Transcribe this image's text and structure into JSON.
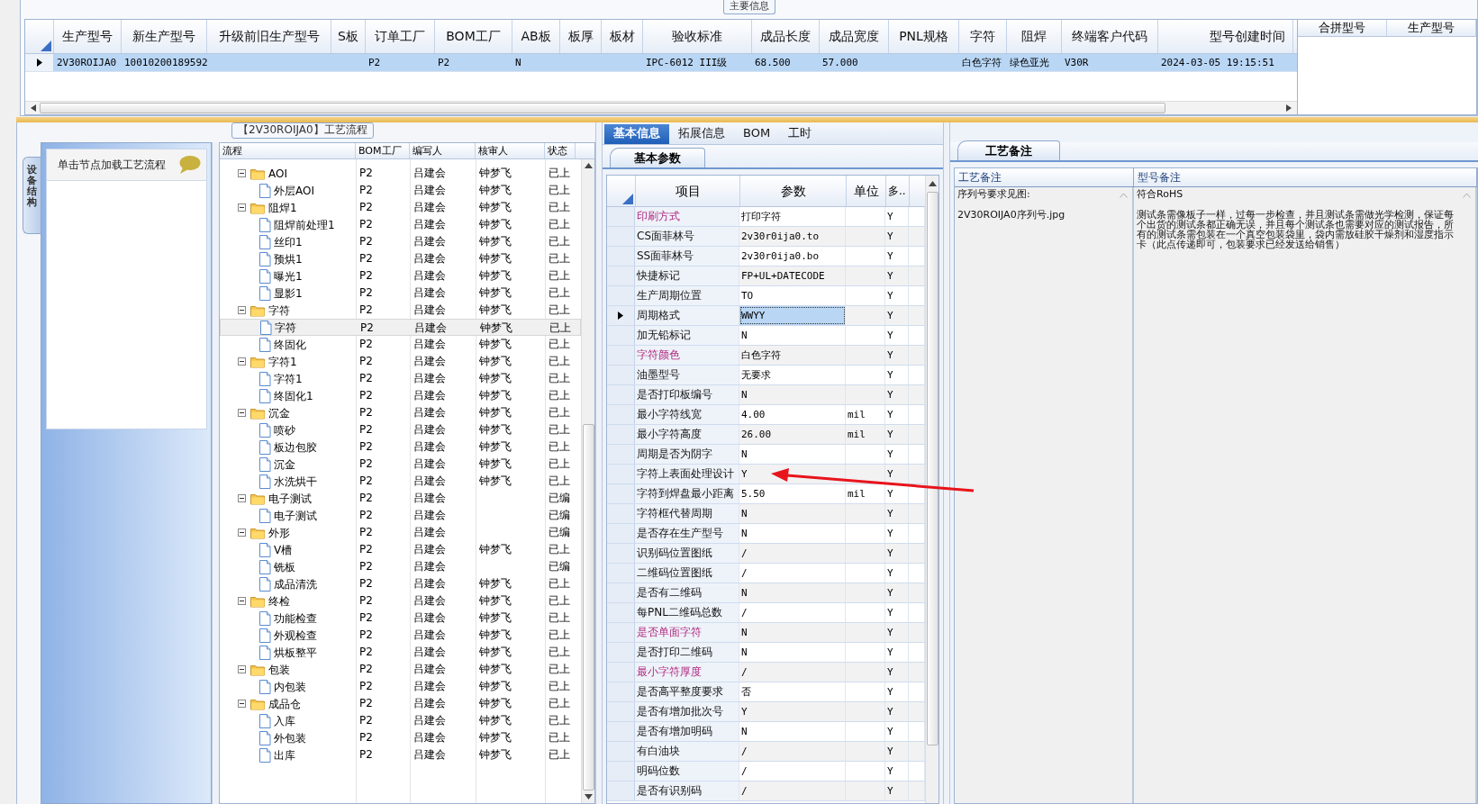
{
  "main_info": {
    "title": "主要信息",
    "columns": [
      "生产型号",
      "新生产型号",
      "升级前旧生产型号",
      "S板",
      "订单工厂",
      "BOM工厂",
      "AB板",
      "板厚",
      "板材",
      "验收标准",
      "成品长度",
      "成品宽度",
      "PNL规格",
      "字符",
      "阻焊",
      "终端客户代码",
      "型号创建时间"
    ],
    "rows": [
      {
        "selected": true,
        "cells": [
          "2V30ROIJA0",
          "10010200189592",
          null,
          null,
          "P2",
          "P2",
          "N",
          null,
          null,
          "IPC-6012 III级",
          "68.500",
          "57.000",
          null,
          "白色字符",
          "绿色亚光",
          "V30R",
          "2024-03-05 19:15:51"
        ]
      }
    ]
  },
  "merge_table": {
    "columns": [
      "合拼型号",
      "生产型号"
    ]
  },
  "process_flow": {
    "title": "【2V30ROIJA0】工艺流程",
    "side_tab": "设备结构",
    "hint": "单击节点加载工艺流程",
    "columns": [
      "流程",
      "BOM工厂",
      "编写人",
      "核审人",
      "状态"
    ],
    "nodes": [
      {
        "name": "AOI",
        "bom": "P2",
        "writer": "吕建会",
        "reviewer": "钟梦飞",
        "status": "已上",
        "selected": false,
        "expanded": true,
        "children": [
          {
            "name": "外层AOI",
            "bom": "P2",
            "writer": "吕建会",
            "reviewer": "钟梦飞",
            "status": "已上",
            "selected": false
          }
        ]
      },
      {
        "name": "阻焊1",
        "bom": "P2",
        "writer": "吕建会",
        "reviewer": "钟梦飞",
        "status": "已上",
        "selected": false,
        "expanded": true,
        "children": [
          {
            "name": "阻焊前处理1",
            "bom": "P2",
            "writer": "吕建会",
            "reviewer": "钟梦飞",
            "status": "已上",
            "selected": false
          },
          {
            "name": "丝印1",
            "bom": "P2",
            "writer": "吕建会",
            "reviewer": "钟梦飞",
            "status": "已上",
            "selected": false
          },
          {
            "name": "预烘1",
            "bom": "P2",
            "writer": "吕建会",
            "reviewer": "钟梦飞",
            "status": "已上",
            "selected": false
          },
          {
            "name": "曝光1",
            "bom": "P2",
            "writer": "吕建会",
            "reviewer": "钟梦飞",
            "status": "已上",
            "selected": false
          },
          {
            "name": "显影1",
            "bom": "P2",
            "writer": "吕建会",
            "reviewer": "钟梦飞",
            "status": "已上",
            "selected": false
          }
        ]
      },
      {
        "name": "字符",
        "bom": "P2",
        "writer": "吕建会",
        "reviewer": "钟梦飞",
        "status": "已上",
        "selected": false,
        "expanded": true,
        "children": [
          {
            "name": "字符",
            "bom": "P2",
            "writer": "吕建会",
            "reviewer": "钟梦飞",
            "status": "已上",
            "selected": true
          },
          {
            "name": "终固化",
            "bom": "P2",
            "writer": "吕建会",
            "reviewer": "钟梦飞",
            "status": "已上",
            "selected": false
          }
        ]
      },
      {
        "name": "字符1",
        "bom": "P2",
        "writer": "吕建会",
        "reviewer": "钟梦飞",
        "status": "已上",
        "selected": false,
        "expanded": true,
        "children": [
          {
            "name": "字符1",
            "bom": "P2",
            "writer": "吕建会",
            "reviewer": "钟梦飞",
            "status": "已上",
            "selected": false
          },
          {
            "name": "终固化1",
            "bom": "P2",
            "writer": "吕建会",
            "reviewer": "钟梦飞",
            "status": "已上",
            "selected": false
          }
        ]
      },
      {
        "name": "沉金",
        "bom": "P2",
        "writer": "吕建会",
        "reviewer": "钟梦飞",
        "status": "已上",
        "selected": false,
        "expanded": true,
        "children": [
          {
            "name": "喷砂",
            "bom": "P2",
            "writer": "吕建会",
            "reviewer": "钟梦飞",
            "status": "已上",
            "selected": false
          },
          {
            "name": "板边包胶",
            "bom": "P2",
            "writer": "吕建会",
            "reviewer": "钟梦飞",
            "status": "已上",
            "selected": false
          },
          {
            "name": "沉金",
            "bom": "P2",
            "writer": "吕建会",
            "reviewer": "钟梦飞",
            "status": "已上",
            "selected": false
          },
          {
            "name": "水洗烘干",
            "bom": "P2",
            "writer": "吕建会",
            "reviewer": "钟梦飞",
            "status": "已上",
            "selected": false
          }
        ]
      },
      {
        "name": "电子测试",
        "bom": "P2",
        "writer": "吕建会",
        "status": "已编",
        "selected": false,
        "expanded": true,
        "children": [
          {
            "name": "电子测试",
            "bom": "P2",
            "writer": "吕建会",
            "status": "已编",
            "selected": false
          }
        ]
      },
      {
        "name": "外形",
        "bom": "P2",
        "writer": "吕建会",
        "status": "已编",
        "selected": false,
        "expanded": true,
        "children": [
          {
            "name": "V槽",
            "bom": "P2",
            "writer": "吕建会",
            "reviewer": "钟梦飞",
            "status": "已上",
            "selected": false
          },
          {
            "name": "铣板",
            "bom": "P2",
            "writer": "吕建会",
            "status": "已编",
            "selected": false
          },
          {
            "name": "成品清洗",
            "bom": "P2",
            "writer": "吕建会",
            "reviewer": "钟梦飞",
            "status": "已上",
            "selected": false
          }
        ]
      },
      {
        "name": "终检",
        "bom": "P2",
        "writer": "吕建会",
        "reviewer": "钟梦飞",
        "status": "已上",
        "selected": false,
        "expanded": true,
        "children": [
          {
            "name": "功能检查",
            "bom": "P2",
            "writer": "吕建会",
            "reviewer": "钟梦飞",
            "status": "已上",
            "selected": false
          },
          {
            "name": "外观检查",
            "bom": "P2",
            "writer": "吕建会",
            "reviewer": "钟梦飞",
            "status": "已上",
            "selected": false
          },
          {
            "name": "烘板整平",
            "bom": "P2",
            "writer": "吕建会",
            "reviewer": "钟梦飞",
            "status": "已上",
            "selected": false
          }
        ]
      },
      {
        "name": "包装",
        "bom": "P2",
        "writer": "吕建会",
        "reviewer": "钟梦飞",
        "status": "已上",
        "selected": false,
        "expanded": true,
        "children": [
          {
            "name": "内包装",
            "bom": "P2",
            "writer": "吕建会",
            "reviewer": "钟梦飞",
            "status": "已上",
            "selected": false
          }
        ]
      },
      {
        "name": "成品仓",
        "bom": "P2",
        "writer": "吕建会",
        "reviewer": "钟梦飞",
        "status": "已上",
        "selected": false,
        "expanded": true,
        "children": [
          {
            "name": "入库",
            "bom": "P2",
            "writer": "吕建会",
            "reviewer": "钟梦飞",
            "status": "已上",
            "selected": false
          },
          {
            "name": "外包装",
            "bom": "P2",
            "writer": "吕建会",
            "reviewer": "钟梦飞",
            "status": "已上",
            "selected": false
          },
          {
            "name": "出库",
            "bom": "P2",
            "writer": "吕建会",
            "reviewer": "钟梦飞",
            "status": "已上",
            "selected": false
          }
        ]
      }
    ]
  },
  "detail_tabs": [
    {
      "label": "基本信息",
      "selected": true
    },
    {
      "label": "拓展信息",
      "selected": false
    },
    {
      "label": "BOM",
      "selected": false
    },
    {
      "label": "工时",
      "selected": false
    }
  ],
  "param_tab": "基本参数",
  "params": {
    "columns": [
      "项目",
      "参数",
      "单位",
      "多.."
    ],
    "rows": [
      {
        "item": "印刷方式",
        "value": "打印字符",
        "flag": "Y",
        "emphasized": true,
        "selected": false
      },
      {
        "item": "CS面菲林号",
        "value": "2v30r0ija0.to",
        "flag": "Y",
        "emphasized": false,
        "selected": false
      },
      {
        "item": "SS面菲林号",
        "value": "2v30r0ija0.bo",
        "flag": "Y",
        "emphasized": false,
        "selected": false
      },
      {
        "item": "快捷标记",
        "value": "FP+UL+DATECODE",
        "flag": "Y",
        "emphasized": false,
        "selected": false
      },
      {
        "item": "生产周期位置",
        "value": "TO",
        "flag": "Y",
        "emphasized": false,
        "selected": false
      },
      {
        "item": "周期格式",
        "value": "WWYY",
        "flag": "Y",
        "emphasized": false,
        "selected": true
      },
      {
        "item": "加无铅标记",
        "value": "N",
        "flag": "Y",
        "emphasized": false,
        "selected": false
      },
      {
        "item": "字符颜色",
        "value": "白色字符",
        "flag": "Y",
        "emphasized": true,
        "selected": false
      },
      {
        "item": "油墨型号",
        "value": "无要求",
        "flag": "Y",
        "emphasized": false,
        "selected": false
      },
      {
        "item": "是否打印板编号",
        "value": "N",
        "flag": "Y",
        "emphasized": false,
        "selected": false
      },
      {
        "item": "最小字符线宽",
        "value": "4.00",
        "unit": "mil",
        "flag": "Y",
        "emphasized": false,
        "selected": false
      },
      {
        "item": "最小字符高度",
        "value": "26.00",
        "unit": "mil",
        "flag": "Y",
        "emphasized": false,
        "selected": false
      },
      {
        "item": "周期是否为阴字",
        "value": "N",
        "flag": "Y",
        "emphasized": false,
        "selected": false
      },
      {
        "item": "字符上表面处理设计",
        "value": "Y",
        "flag": "Y",
        "emphasized": false,
        "selected": false
      },
      {
        "item": "字符到焊盘最小距离",
        "value": "5.50",
        "unit": "mil",
        "flag": "Y",
        "emphasized": false,
        "selected": false
      },
      {
        "item": "字符框代替周期",
        "value": "N",
        "flag": "Y",
        "emphasized": false,
        "selected": false
      },
      {
        "item": "是否存在生产型号",
        "value": "N",
        "flag": "Y",
        "emphasized": false,
        "selected": false
      },
      {
        "item": "识别码位置图纸",
        "value": "/",
        "flag": "Y",
        "emphasized": false,
        "selected": false
      },
      {
        "item": "二维码位置图纸",
        "value": "/",
        "flag": "Y",
        "emphasized": false,
        "selected": false
      },
      {
        "item": "是否有二维码",
        "value": "N",
        "flag": "Y",
        "emphasized": false,
        "selected": false
      },
      {
        "item": "每PNL二维码总数",
        "value": "/",
        "flag": "Y",
        "emphasized": false,
        "selected": false
      },
      {
        "item": "是否单面字符",
        "value": "N",
        "flag": "Y",
        "emphasized": true,
        "selected": false
      },
      {
        "item": "是否打印二维码",
        "value": "N",
        "flag": "Y",
        "emphasized": false,
        "selected": false
      },
      {
        "item": "最小字符厚度",
        "value": "/",
        "flag": "Y",
        "emphasized": true,
        "selected": false
      },
      {
        "item": "是否高平整度要求",
        "value": "否",
        "flag": "Y",
        "emphasized": false,
        "selected": false
      },
      {
        "item": "是否有增加批次号",
        "value": "Y",
        "flag": "Y",
        "emphasized": false,
        "selected": false
      },
      {
        "item": "是否有增加明码",
        "value": "N",
        "flag": "Y",
        "emphasized": false,
        "selected": false
      },
      {
        "item": "有白油块",
        "value": "/",
        "flag": "Y",
        "emphasized": false,
        "selected": false
      },
      {
        "item": "明码位数",
        "value": "/",
        "flag": "Y",
        "emphasized": false,
        "selected": false
      },
      {
        "item": "是否有识别码",
        "value": "/",
        "flag": "Y",
        "emphasized": false,
        "selected": false
      }
    ]
  },
  "notes": {
    "tab": "工艺备注",
    "columns": [
      "工艺备注",
      "型号备注"
    ],
    "process_note": [
      "序列号要求见图:",
      "2V30ROIJA0序列号.jpg"
    ],
    "model_note": [
      "符合RoHS",
      "测试条需像板子一样，过每一步检查，并且测试条需做光学检测，保证每个出货的测试条都正确无误，并且每个测试条也需要对应的测试报告，所有的测试条需包装在一个真空包装袋里，袋内需放硅胶干燥剂和湿度指示卡（此点传递即可，包装要求已经发送给销售）"
    ]
  }
}
